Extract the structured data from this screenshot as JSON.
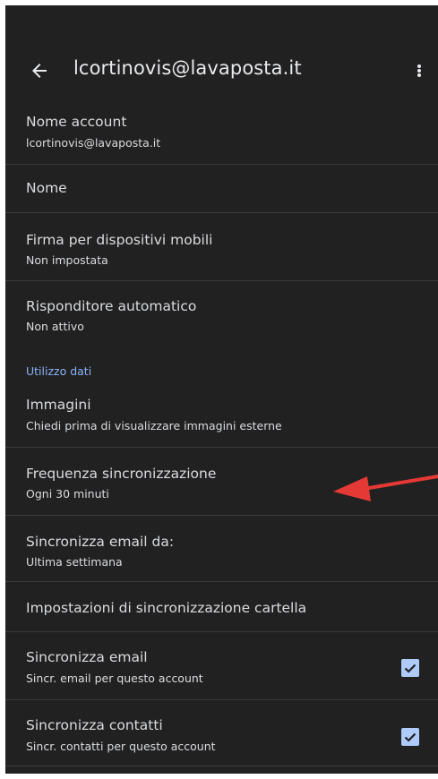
{
  "header": {
    "title": "lcortinovis@lavaposta.it",
    "back_icon": "arrow-back-icon",
    "menu_icon": "more-vert-icon"
  },
  "settings": [
    {
      "title": "Nome account",
      "subtitle": "lcortinovis@lavaposta.it"
    },
    {
      "title": "Nome"
    },
    {
      "title": "Firma per dispositivi mobili",
      "subtitle": "Non impostata"
    },
    {
      "title": "Risponditore automatico",
      "subtitle": "Non attivo"
    },
    {
      "title": "Immagini",
      "subtitle": "Chiedi prima di visualizzare immagini esterne"
    },
    {
      "title": "Frequenza sincronizzazione",
      "subtitle": "Ogni 30 minuti"
    },
    {
      "title": "Sincronizza email da:",
      "subtitle": "Ultima settimana"
    },
    {
      "title": "Impostazioni di sincronizzazione cartella"
    },
    {
      "title": "Sincronizza email",
      "subtitle": "Sincr. email per questo account",
      "checked": true
    },
    {
      "title": "Sincronizza contatti",
      "subtitle": "Sincr. contatti per questo account",
      "checked": true
    }
  ],
  "section_header": "Utilizzo dati",
  "colors": {
    "background": "#212121",
    "accent": "#8ab4f8",
    "checkbox": "#aecbfa",
    "annotation_arrow": "#e53935"
  }
}
